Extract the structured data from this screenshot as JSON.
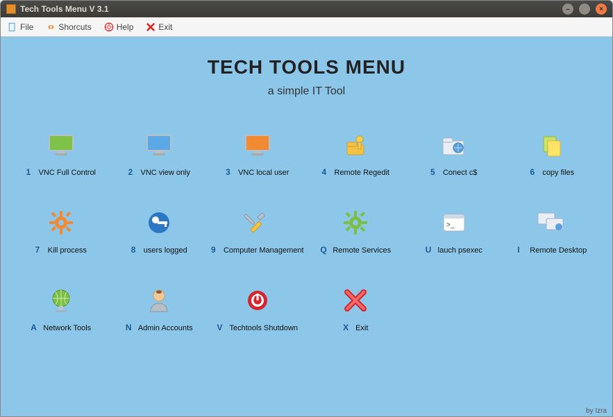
{
  "window": {
    "title": "Tech Tools Menu V 3.1"
  },
  "menubar": {
    "file": "File",
    "shortcuts": "Shorcuts",
    "help": "Help",
    "exit": "Exit"
  },
  "heading": "TECH TOOLS MENU",
  "subheading": "a simple IT Tool",
  "items": {
    "i1": {
      "key": "1",
      "label": "VNC Full Control"
    },
    "i2": {
      "key": "2",
      "label": "VNC view only"
    },
    "i3": {
      "key": "3",
      "label": "VNC local user"
    },
    "i4": {
      "key": "4",
      "label": "Remote Regedit"
    },
    "i5": {
      "key": "5",
      "label": "Conect c$"
    },
    "i6": {
      "key": "6",
      "label": "copy files"
    },
    "i7": {
      "key": "7",
      "label": "Kill process"
    },
    "i8": {
      "key": "8",
      "label": "users logged"
    },
    "i9": {
      "key": "9",
      "label": "Computer Management"
    },
    "iQ": {
      "key": "Q",
      "label": "Remote Services"
    },
    "iU": {
      "key": "U",
      "label": "lauch psexec"
    },
    "iI": {
      "key": "I",
      "label": "Remote Desktop"
    },
    "iA": {
      "key": "A",
      "label": "Network Tools"
    },
    "iN": {
      "key": "N",
      "label": "Admin  Accounts"
    },
    "iV": {
      "key": "V",
      "label": "Techtools Shutdown"
    },
    "iX": {
      "key": "X",
      "label": "Exit"
    }
  },
  "footer": "by Izra"
}
